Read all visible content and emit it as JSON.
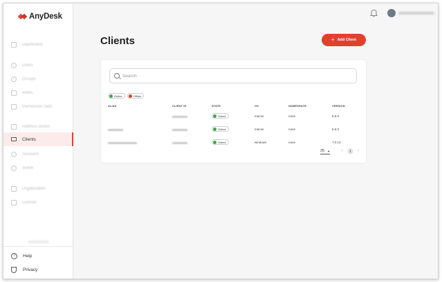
{
  "app": {
    "name": "AnyDesk"
  },
  "sidebar": {
    "items": [
      {
        "label": "Dashboard",
        "icon": "dashboard-icon"
      },
      {
        "label": "Users",
        "icon": "user-icon"
      },
      {
        "label": "Groups",
        "icon": "group-icon"
      },
      {
        "label": "Roles",
        "icon": "roles-icon"
      },
      {
        "label": "Permission Sets",
        "icon": "permission-icon"
      },
      {
        "label": "Address Books",
        "icon": "address-book-icon"
      },
      {
        "label": "Clients",
        "icon": "monitor-icon"
      },
      {
        "label": "Sessions",
        "icon": "session-icon"
      },
      {
        "label": "Builds",
        "icon": "build-icon"
      },
      {
        "label": "Organization",
        "icon": "organization-icon"
      },
      {
        "label": "License",
        "icon": "license-icon"
      }
    ],
    "active": "Clients",
    "footer": [
      {
        "label": "Help",
        "icon": "help-icon"
      },
      {
        "label": "Privacy",
        "icon": "shield-icon"
      }
    ]
  },
  "header": {
    "user_name_hidden": true
  },
  "main": {
    "title": "Clients",
    "add_button": "Add Client",
    "search_placeholder": "Search",
    "filters": [
      {
        "label": "Online",
        "status": "online"
      },
      {
        "label": "Offline",
        "status": "offline"
      }
    ],
    "columns": [
      "ALIAS",
      "CLIENT ID",
      "STATE",
      "OS",
      "NAMESPACE",
      "VERSION"
    ],
    "rows": [
      {
        "alias": "",
        "client_id": "",
        "state": "Online",
        "os": "macos",
        "namespace": "none",
        "version": "6.6.0"
      },
      {
        "alias": "",
        "client_id": "",
        "state": "Online",
        "os": "macos",
        "namespace": "none",
        "version": "6.6.0"
      },
      {
        "alias": "",
        "client_id": "",
        "state": "Online",
        "os": "windows",
        "namespace": "none",
        "version": "7.0.14"
      }
    ],
    "pagination": {
      "page_size": "25",
      "current_page": "1"
    }
  },
  "colors": {
    "accent": "#e2402e",
    "online": "#3ba64b",
    "offline": "#e2402e",
    "active_bg": "#fbeceb"
  }
}
